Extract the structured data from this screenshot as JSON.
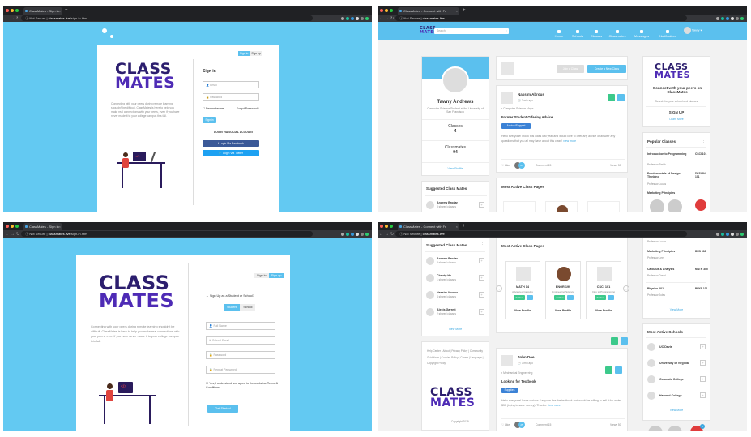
{
  "browser": {
    "not_secure": "Not Secure",
    "tab_signin": "ClassMates - Sign in",
    "tab_connect": "ClassMates - Connect with Fr",
    "url_signin_host": "classmates.live",
    "url_signin_path": "/sign-in.html",
    "url_home_host": "classmates.live"
  },
  "signin": {
    "logo_line1": "CLASS",
    "logo_line2": "MATES",
    "tagline": "Connecting with your peers during remote learning shouldn't be difficult. ClassMates is here to help you make real connections with your peers, even if you have never made it to your college campus this fall.",
    "toggle_signin": "Sign in",
    "toggle_signup": "Sign up",
    "heading": "Sign in",
    "email_placeholder": "Email",
    "password_placeholder": "Password",
    "remember": "Remember me",
    "forgot": "Forgot Password?",
    "submit": "Sign in",
    "social_heading": "LOGIN VIA SOCIAL ACCOUNT",
    "facebook": "Login Via Facebook",
    "twitter": "Login Via Twitter"
  },
  "signup": {
    "toggle_signin": "Sign in",
    "toggle_signup": "Sign up",
    "heading": "Sign Up as a Student or School?",
    "opt_student": "Student",
    "opt_school": "School",
    "full_name": "Full Name",
    "school_email": "School Email",
    "password": "Password",
    "repeat_password": "Repeat Password",
    "terms": "Yes, I understand and agree to the workwise Terms & Conditions.",
    "submit": "Get Started",
    "tagline": "Connecting with your peers during remote learning shouldn't be difficult. ClassMates is here to help you make real connections with your peers, even if you have never made it to your college campus this fall."
  },
  "home": {
    "search_placeholder": "Search",
    "nav": [
      "Home",
      "Schools",
      "Classes",
      "Classmates",
      "Messages",
      "Notification"
    ],
    "user_short": "Tawny",
    "profile": {
      "name": "Tawny Andrews",
      "subtitle": "Computer Science Student at the University of San Francisco",
      "classes_label": "Classes",
      "classes_value": "4",
      "classmates_label": "Classmates",
      "classmates_value": "94",
      "view_profile": "View Profile"
    },
    "join_class": "Join a Class",
    "create_class": "Create a New Class",
    "post1": {
      "author": "Nassim Abrous",
      "time": "3 min ago",
      "major": "Computer Science Major",
      "title": "Former Student Offering Advice",
      "tag": "Advice/Support",
      "body": "Hello everyone! I took this class last year and would love to offer any advice or answer any questions that you all may have about this class!",
      "view_more": "view more",
      "like": "Like",
      "like_count": "25",
      "comment": "Comment 15",
      "views": "Views 50"
    },
    "suggested_heading": "Suggested Class Mates",
    "suggested": [
      {
        "name": "Andrew Brodar",
        "sub": "3 shared classes"
      },
      {
        "name": "Christy Hu",
        "sub": "1 shared classes"
      },
      {
        "name": "Nassim Abrous",
        "sub": "4 shared classes"
      },
      {
        "name": "Alexis Garrett",
        "sub": "2 shared classes"
      }
    ],
    "view_more": "View More",
    "active_heading": "Most Active Class Pages",
    "active_pages": [
      {
        "code": "MATH 14",
        "sub": "Advanced Calculus",
        "btn": "View Profile"
      },
      {
        "code": "ENGR 199",
        "sub": "Engineering Science",
        "btn": "View Profile"
      },
      {
        "code": "CSCI 101",
        "sub": "Intro to Programming",
        "btn": "View Profile"
      }
    ],
    "follow": "Follow",
    "promo": {
      "title": "Connect with your peers on ClassMates",
      "sub": "Search for your school and classes",
      "signup": "SIGN UP",
      "learn": "Learn More"
    },
    "popular_heading": "Popular Classes",
    "popular": [
      {
        "name": "Introduction to Programming",
        "prof": "Professor Smith",
        "code": "CSCI 101"
      },
      {
        "name": "Fundamentals of Design Thinking",
        "prof": "Professor Lucas",
        "code": "DESIGN 101"
      },
      {
        "name": "Marketing Principles",
        "prof": "Professor Lee",
        "code": "BUS 302"
      },
      {
        "name": "Calculus & Analysis",
        "prof": "Professor David",
        "code": "MATH 305"
      },
      {
        "name": "Physics 101",
        "prof": "Professor Jules",
        "code": "PHYS 101"
      }
    ],
    "schools_heading": "Most Active Schools",
    "schools": [
      "UC Davis",
      "University of Virginia",
      "Colorado College",
      "Harvard College"
    ],
    "footer_links": [
      "Help Center",
      "About",
      "Privacy Policy",
      "Community Guidelines",
      "Cookies Policy",
      "Career",
      "Language",
      "Copyright Policy"
    ],
    "copyright": "Copyright 2019",
    "post2": {
      "author": "John Doe",
      "time": "3 min ago",
      "major": "Mechanical Engineering",
      "title": "Looking for Textbook",
      "tag": "Supplies",
      "body": "Hello everyone! I was curious if anyone has the textbook and would be willing to sell it for under $50 (trying to save money). Thanks.",
      "view_more": "view more",
      "like": "Like",
      "like_count": "25",
      "comment": "Comment 15",
      "views": "Views 50"
    },
    "badge_count": "1"
  },
  "colors": {
    "sky": "#63c9f2",
    "nav": "#5bc0ee",
    "brand": "#2c1e6e",
    "facebook": "#3b5998",
    "twitter": "#1da1f2"
  }
}
